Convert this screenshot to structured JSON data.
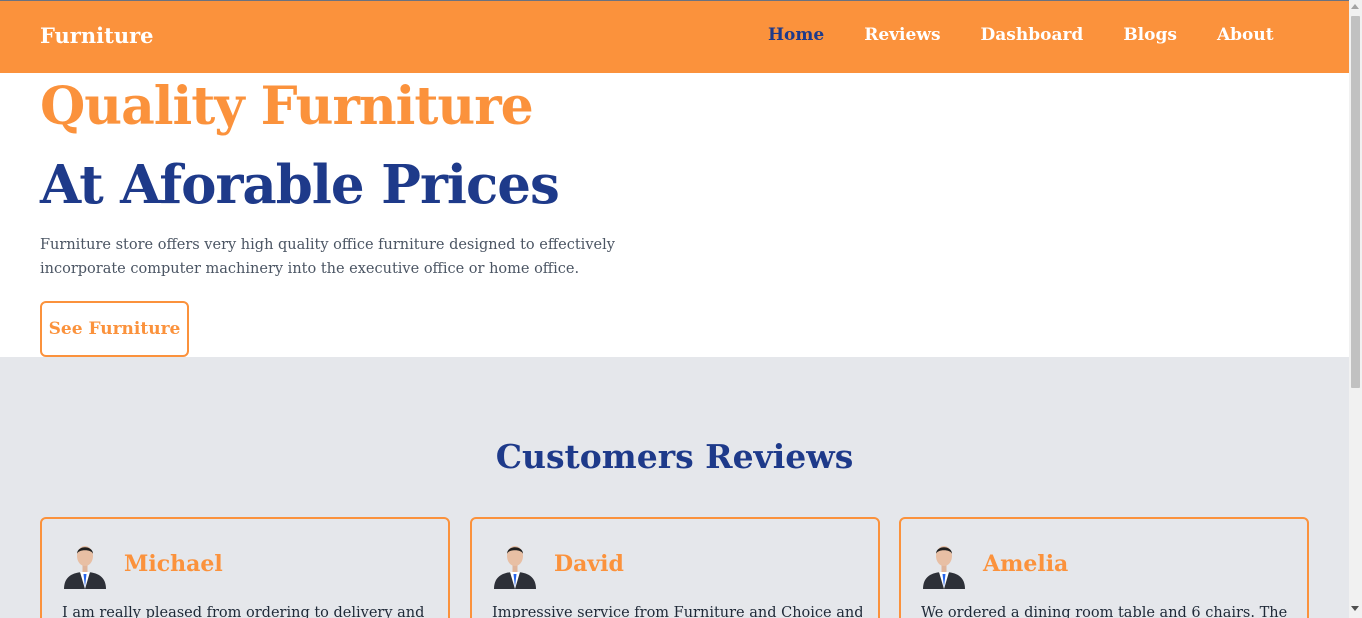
{
  "nav": {
    "brand": "Furniture",
    "links": [
      {
        "label": "Home",
        "active": true
      },
      {
        "label": "Reviews",
        "active": false
      },
      {
        "label": "Dashboard",
        "active": false
      },
      {
        "label": "Blogs",
        "active": false
      },
      {
        "label": "About",
        "active": false
      }
    ]
  },
  "hero": {
    "title_line1": "Quality Furniture",
    "title_line2": "At Aforable Prices",
    "description": "Furniture store offers very high quality office furniture designed to effectively incorporate computer machinery into the executive office or home office.",
    "button_label": "See Furniture"
  },
  "reviews": {
    "title": "Customers Reviews",
    "cards": [
      {
        "name": "Michael",
        "text": "I am really pleased from ordering to delivery and",
        "avatar_icon": "person-avatar-icon"
      },
      {
        "name": "David",
        "text": "Impressive service from Furniture and Choice and",
        "avatar_icon": "person-avatar-icon"
      },
      {
        "name": "Amelia",
        "text": "We ordered a dining room table and 6 chairs. The",
        "avatar_icon": "person-avatar-icon"
      }
    ]
  },
  "colors": {
    "accent": "#fb923c",
    "primary": "#1e3a8a",
    "section_bg": "#e5e7eb"
  }
}
